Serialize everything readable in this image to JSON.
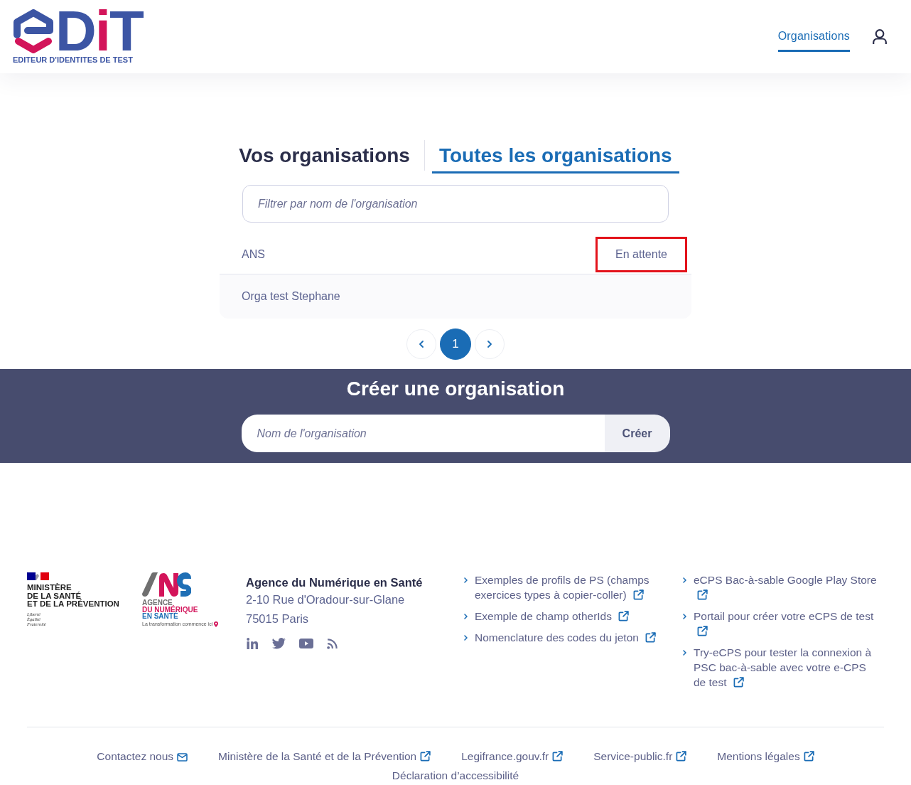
{
  "header": {
    "logo": {
      "letters": [
        {
          "text": "D",
          "color": "#3c55a4"
        },
        {
          "text": "i",
          "color": "#d3145a"
        },
        {
          "text": "T",
          "color": "#3c55a4"
        }
      ],
      "tagline": "EDITEUR D'IDENTITES DE TEST"
    },
    "nav": [
      {
        "label": "Organisations",
        "selected": true
      }
    ]
  },
  "tabs": [
    {
      "label": "Vos organisations",
      "selected": false
    },
    {
      "label": "Toutes les organisations",
      "selected": true
    }
  ],
  "filter": {
    "placeholder": "Filtrer par nom de l'organisation"
  },
  "organisations": [
    {
      "name": "ANS",
      "status": "En attente",
      "highlighted": true
    },
    {
      "name": "Orga test Stephane"
    }
  ],
  "pagination": {
    "pages": [
      {
        "label": "1",
        "selected": true
      }
    ]
  },
  "create": {
    "title": "Créer une organisation",
    "placeholder": "Nom de l'organisation",
    "button": "Créer"
  },
  "footer": {
    "ministry": {
      "name_lines": [
        "MINISTÈRE",
        "DE LA SANTÉ",
        "ET DE LA PRÉVENTION"
      ],
      "motto_lines": [
        "Liberté",
        "Égalité",
        "Fraternité"
      ]
    },
    "agency_logo": {
      "lines": [
        {
          "text": "AGENCE",
          "color": "#6f6f6f"
        },
        {
          "text": "DU NUMÉRIQUE",
          "color": "#d3145a"
        },
        {
          "text": "EN SANTÉ",
          "color": "#1f6fb5"
        }
      ],
      "tagline": "La transformation commence ici"
    },
    "address": {
      "name": "Agence du Numérique en Santé",
      "lines": [
        "2-10 Rue d'Oradour-sur-Glane",
        "75015 Paris"
      ]
    },
    "social": [
      {
        "kind": "linkedin"
      },
      {
        "kind": "twitter"
      },
      {
        "kind": "youtube"
      },
      {
        "kind": "rss"
      }
    ],
    "link_columns": [
      [
        {
          "text": "Exemples de profils de PS (champs exercices types à copier-coller)",
          "external": true
        },
        {
          "text": "Exemple de champ otherIds",
          "external": true
        },
        {
          "text": "Nomenclature des codes du jeton",
          "external": true
        }
      ],
      [
        {
          "text": "eCPS Bac-à-sable Google Play Store",
          "external": true
        },
        {
          "text": "Portail pour créer votre eCPS de test",
          "external": true
        },
        {
          "text": "Try-eCPS pour tester la connexion à PSC bac-à-sable avec votre e-CPS de test",
          "external": true
        }
      ]
    ],
    "bottom_links": [
      {
        "text": "Contactez nous",
        "kind": "mail"
      },
      {
        "text": "Ministère de la Santé et de la Prévention",
        "kind": "external"
      },
      {
        "text": "Legifrance.gouv.fr",
        "kind": "external"
      },
      {
        "text": "Service-public.fr",
        "kind": "external"
      },
      {
        "text": "Mentions légales",
        "kind": "external"
      },
      {
        "text": "Déclaration d’accessibilité",
        "kind": "plain"
      }
    ]
  }
}
